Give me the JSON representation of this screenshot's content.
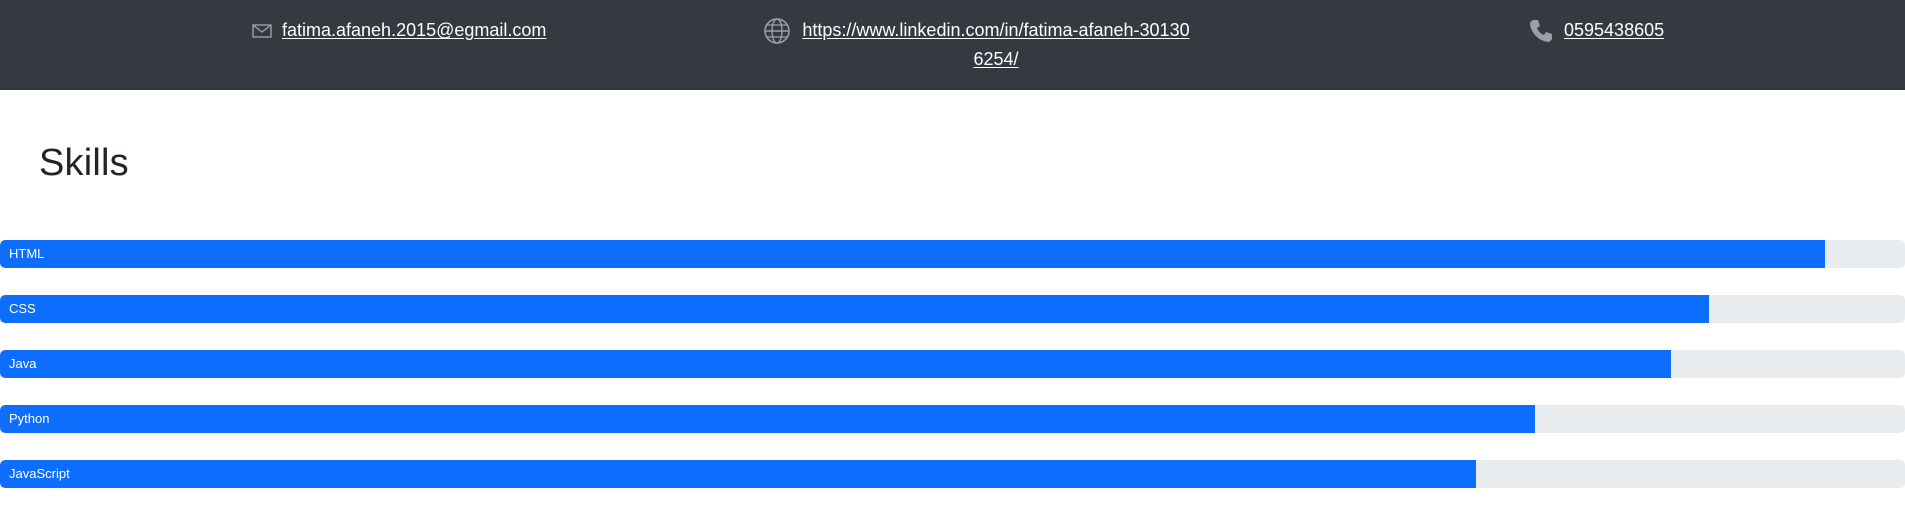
{
  "header": {
    "email": {
      "text": "fatima.afaneh.2015@egmail.com",
      "icon": "envelope-icon"
    },
    "linkedin": {
      "text": "https://www.linkedin.com/in/fatima-afaneh-301306254/",
      "icon": "globe-icon"
    },
    "phone": {
      "text": "0595438605",
      "icon": "phone-icon"
    }
  },
  "skills_section": {
    "title": "Skills",
    "items": [
      {
        "label": "HTML",
        "percent": 95.8
      },
      {
        "label": "CSS",
        "percent": 89.7
      },
      {
        "label": "Java",
        "percent": 87.7
      },
      {
        "label": "Python",
        "percent": 80.6
      },
      {
        "label": "JavaScript",
        "percent": 77.5
      }
    ]
  },
  "colors": {
    "header_bg": "#343a40",
    "bar_fill": "#0d6efd",
    "bar_track": "#e9ecef",
    "title_text": "#212529"
  }
}
